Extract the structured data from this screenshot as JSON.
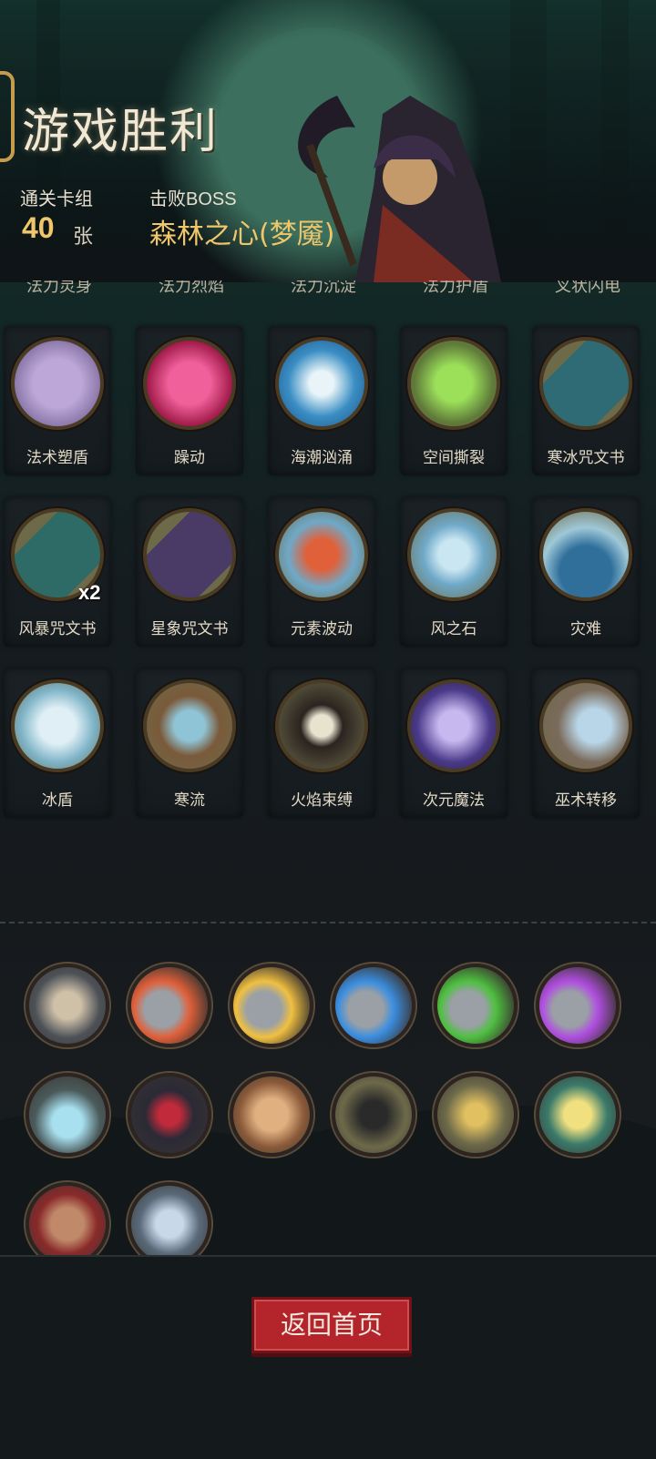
{
  "header": {
    "title": "游戏胜利",
    "deck_label": "通关卡组",
    "deck_count": "40",
    "deck_unit": "张",
    "boss_label": "击败BOSS",
    "boss_name": "森林之心(梦魇)"
  },
  "partial_row": [
    "法力灵身",
    "法力烈焰",
    "法力沉淀",
    "法力护盾",
    "叉状闪电"
  ],
  "cards": [
    {
      "name": "法术塑盾",
      "icon": "mage-shield-icon",
      "count": ""
    },
    {
      "name": "躁动",
      "icon": "demon-mask-icon",
      "count": ""
    },
    {
      "name": "海潮汹涌",
      "icon": "tidal-wave-icon",
      "count": ""
    },
    {
      "name": "空间撕裂",
      "icon": "space-rift-icon",
      "count": ""
    },
    {
      "name": "寒冰咒文书",
      "icon": "ice-spellbook-icon",
      "count": ""
    },
    {
      "name": "风暴咒文书",
      "icon": "storm-spellbook-icon",
      "count": "x2"
    },
    {
      "name": "星象咒文书",
      "icon": "star-spellbook-icon",
      "count": ""
    },
    {
      "name": "元素波动",
      "icon": "element-wave-icon",
      "count": ""
    },
    {
      "name": "风之石",
      "icon": "wind-stone-icon",
      "count": ""
    },
    {
      "name": "灾难",
      "icon": "disaster-wave-icon",
      "count": ""
    },
    {
      "name": "冰盾",
      "icon": "ice-shield-icon",
      "count": ""
    },
    {
      "name": "寒流",
      "icon": "cold-current-icon",
      "count": ""
    },
    {
      "name": "火焰束缚",
      "icon": "skeleton-bound-icon",
      "count": ""
    },
    {
      "name": "次元魔法",
      "icon": "dimension-magic-icon",
      "count": ""
    },
    {
      "name": "巫术转移",
      "icon": "wizard-transfer-icon",
      "count": ""
    }
  ],
  "relics": [
    {
      "icon": "old-sage-icon"
    },
    {
      "icon": "bard-red-icon"
    },
    {
      "icon": "bard-yellow-icon"
    },
    {
      "icon": "bard-blue-icon"
    },
    {
      "icon": "bard-green-icon"
    },
    {
      "icon": "bard-purple-icon"
    },
    {
      "icon": "campfire-icon"
    },
    {
      "icon": "red-book-icon"
    },
    {
      "icon": "bearded-pirate-icon"
    },
    {
      "icon": "tornado-icon"
    },
    {
      "icon": "gold-sword-icon"
    },
    {
      "icon": "open-spellbook-icon"
    },
    {
      "icon": "bleeding-brawler-icon"
    },
    {
      "icon": "dagger-icon"
    }
  ],
  "home_button": "返回首页",
  "colors": {
    "accent_gold": "#f0c66b",
    "button_red": "#b3242b"
  }
}
